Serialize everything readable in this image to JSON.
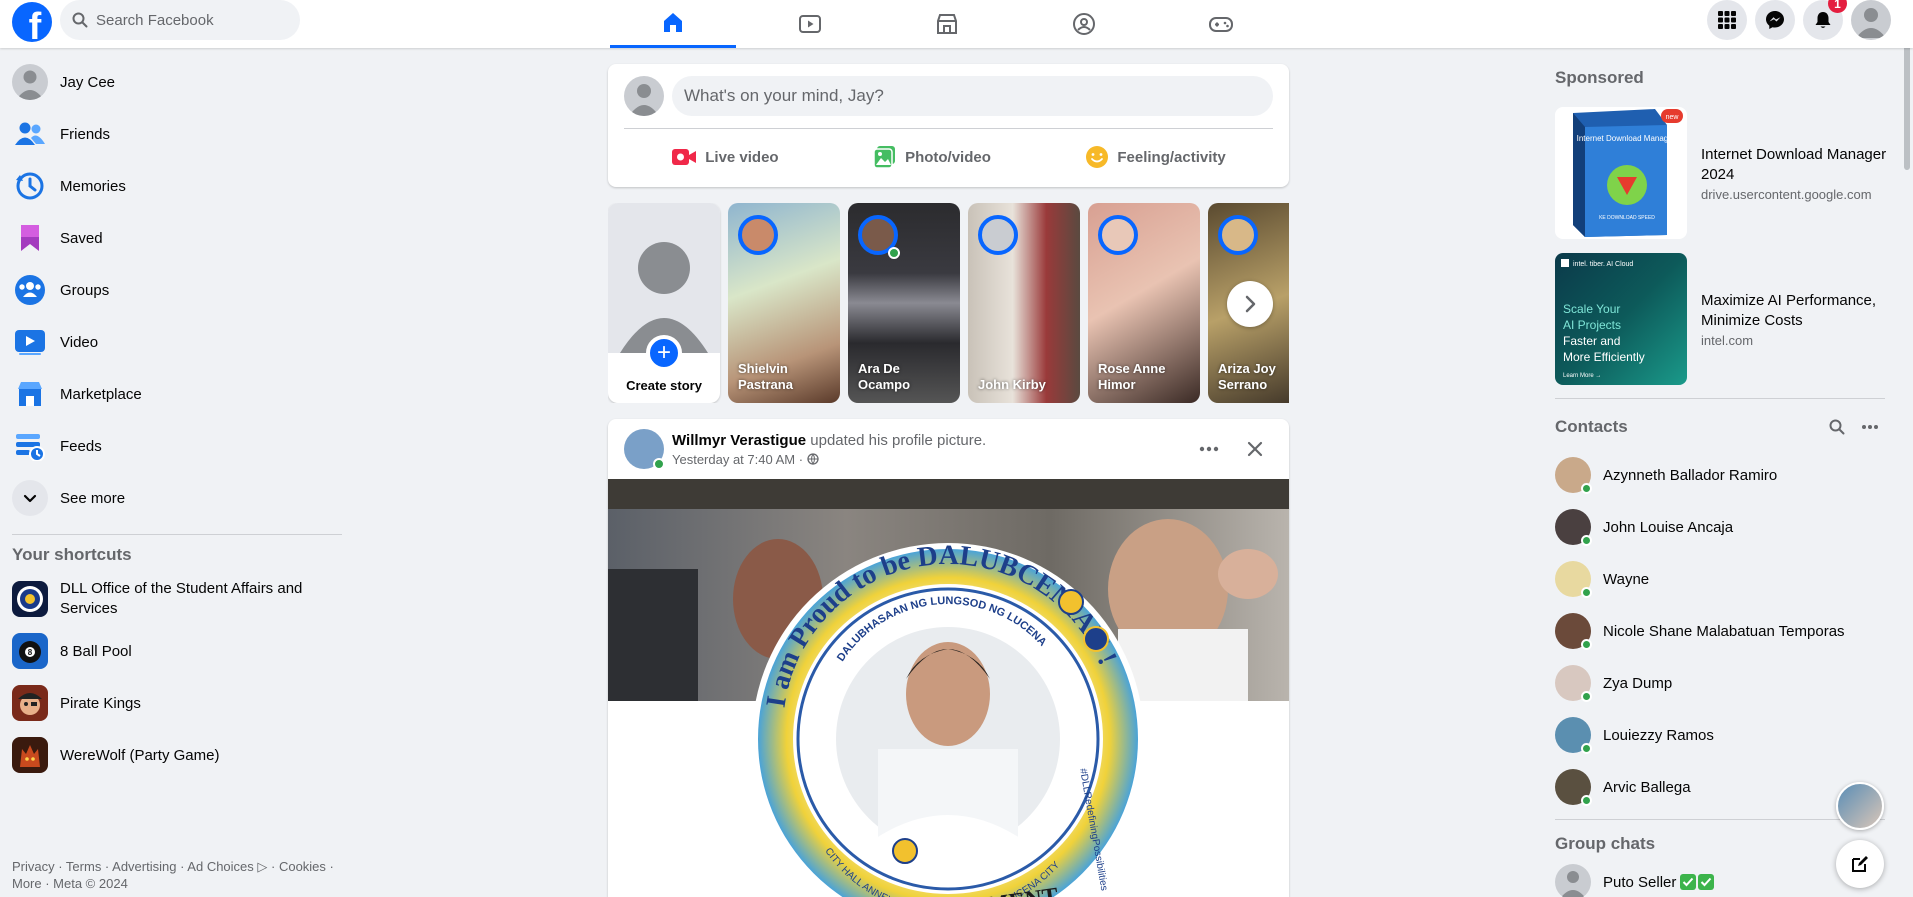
{
  "header": {
    "logo": "f",
    "search_placeholder": "Search Facebook",
    "notifications_count": "1",
    "nav_tabs": [
      "Home",
      "Video",
      "Marketplace",
      "Groups",
      "Gaming"
    ]
  },
  "left_nav": {
    "items": [
      {
        "label": "Jay Cee",
        "icon": "profile-avatar"
      },
      {
        "label": "Friends",
        "icon": "friends-icon"
      },
      {
        "label": "Memories",
        "icon": "memories-icon"
      },
      {
        "label": "Saved",
        "icon": "saved-icon"
      },
      {
        "label": "Groups",
        "icon": "groups-icon"
      },
      {
        "label": "Video",
        "icon": "video-icon"
      },
      {
        "label": "Marketplace",
        "icon": "marketplace-icon"
      },
      {
        "label": "Feeds",
        "icon": "feeds-icon"
      },
      {
        "label": "See more",
        "icon": "chevron-down-icon"
      }
    ],
    "shortcuts_title": "Your shortcuts",
    "shortcuts": [
      {
        "label": "DLL Office of the Student Affairs and Services"
      },
      {
        "label": "8 Ball Pool"
      },
      {
        "label": "Pirate Kings"
      },
      {
        "label": "WereWolf (Party Game)"
      }
    ],
    "footer": "Privacy · Terms · Advertising · Ad Choices ▷ · Cookies · More · Meta © 2024"
  },
  "composer": {
    "placeholder": "What's on your mind, Jay?",
    "actions": [
      "Live video",
      "Photo/video",
      "Feeling/activity"
    ]
  },
  "stories": {
    "create_label": "Create story",
    "items": [
      {
        "name": "Shielvin Pastrana"
      },
      {
        "name": "Ara De Ocampo"
      },
      {
        "name": "John Kirby"
      },
      {
        "name": "Rose Anne Himor"
      },
      {
        "name": "Ariza Joy Serrano"
      }
    ]
  },
  "post": {
    "author": "Willmyr Verastigue",
    "action": " updated his profile picture.",
    "time": "Yesterday at 7:40 AM ·",
    "frame_top_text": "I am Proud to be DALUBCENIAN !",
    "frame_bottom_text": "BSIT DEPARTMENT",
    "frame_ring_text": "DALUBHASAAN NG LUNGSOD NG LUCENA",
    "frame_ring_text2": "CITY HALL ANNEX COMPOUND, ISABANG, LUCENA CITY",
    "frame_side_text": "#DLLRedefiningPossibilities"
  },
  "sponsored": {
    "title": "Sponsored",
    "ads": [
      {
        "title": "Internet Download Manager 2024",
        "url": "drive.usercontent.google.com",
        "thumb_title": "Internet Download Manager",
        "thumb_sub": "KE DOWNLOAD SPEED",
        "thumb_badge": "new"
      },
      {
        "title": "Maximize AI Performance, Minimize Costs",
        "url": "intel.com",
        "thumb_brand": "intel. tiber. AI Cloud",
        "thumb_line1": "Scale Your",
        "thumb_line2": "AI Projects",
        "thumb_line3": "Faster and",
        "thumb_line4": "More Efficiently",
        "thumb_cta": "Learn More →"
      }
    ]
  },
  "contacts": {
    "title": "Contacts",
    "items": [
      {
        "name": "Azynneth Ballador Ramiro",
        "color": "#c9a98a"
      },
      {
        "name": "John Louise Ancaja",
        "color": "#4a4040"
      },
      {
        "name": "Wayne",
        "color": "#e8d9a0"
      },
      {
        "name": "Nicole Shane Malabatuan Temporas",
        "color": "#6b4a3a"
      },
      {
        "name": "Zya Dump",
        "color": "#d8c8c0"
      },
      {
        "name": "Louiezzy Ramos",
        "color": "#5b8fb0"
      },
      {
        "name": "Arvic Ballega",
        "color": "#5a5040"
      }
    ]
  },
  "group_chats": {
    "title": "Group chats",
    "items": [
      {
        "name": "Puto Seller"
      }
    ]
  },
  "colors": {
    "brand": "#0866ff",
    "online": "#31a24c",
    "alert": "#e41e3f"
  }
}
